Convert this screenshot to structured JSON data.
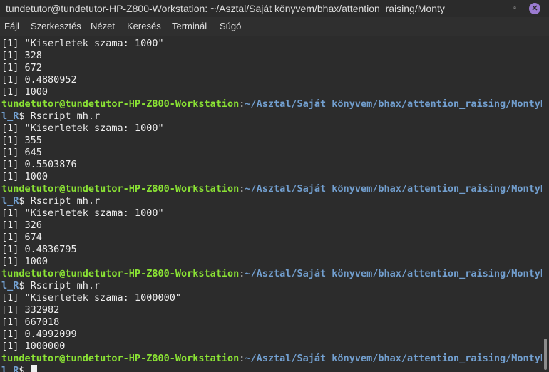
{
  "window": {
    "title": "tundetutor@tundetutor-HP-Z800-Workstation: ~/Asztal/Saját könyvem/bhax/attention_raising/Monty",
    "minimize_glyph": "–",
    "maximize_glyph": "▫",
    "close_glyph": "✕"
  },
  "menu": [
    "Fájl",
    "Szerkesztés",
    "Nézet",
    "Keresés",
    "Terminál",
    "Súgó"
  ],
  "terminal": {
    "user_host": "tundetutor@tundetutor-HP-Z800-Workstation",
    "colon": ":",
    "path_line1": "~/Asztal/Saját könyvem/bhax/attention_raising/MontyH",
    "path_line2": "l_R",
    "prompt_symbol": "$ ",
    "command": "Rscript mh.r",
    "block0": [
      "[1] \"Kiserletek szama: 1000\"",
      "[1] 328",
      "[1] 672",
      "[1] 0.4880952",
      "[1] 1000"
    ],
    "block1": [
      "[1] \"Kiserletek szama: 1000\"",
      "[1] 355",
      "[1] 645",
      "[1] 0.5503876",
      "[1] 1000"
    ],
    "block2": [
      "[1] \"Kiserletek szama: 1000\"",
      "[1] 326",
      "[1] 674",
      "[1] 0.4836795",
      "[1] 1000"
    ],
    "block3": [
      "[1] \"Kiserletek szama: 1000000\"",
      "[1] 332982",
      "[1] 667018",
      "[1] 0.4992099",
      "[1] 1000000"
    ]
  },
  "colors": {
    "user_host": "#8ae234",
    "path": "#729fcf",
    "text": "#eeeeee",
    "background": "#2c2c2c",
    "close_button": "#9b7bd1"
  }
}
